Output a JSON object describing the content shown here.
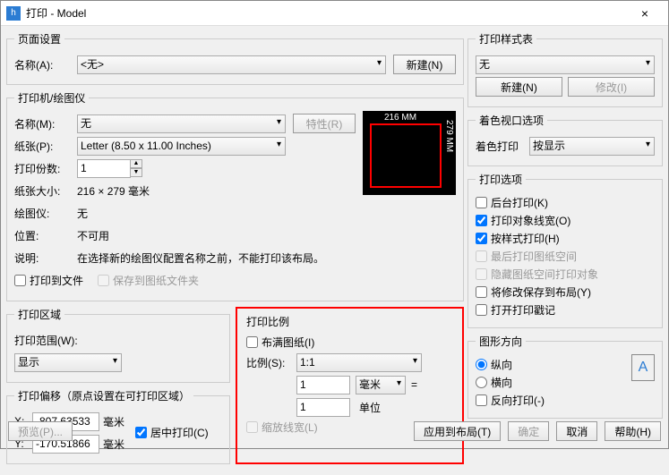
{
  "window": {
    "title": "打印 - Model",
    "close": "×",
    "icon": "h"
  },
  "pageSetup": {
    "legend": "页面设置",
    "nameLabel": "名称(A):",
    "nameValue": "<无>",
    "newBtn": "新建(N)"
  },
  "printer": {
    "legend": "打印机/绘图仪",
    "nameLabel": "名称(M):",
    "nameValue": "无",
    "propsBtn": "特性(R)",
    "paperLabel": "纸张(P):",
    "paperValue": "Letter (8.50 x 11.00 Inches)",
    "copiesLabel": "打印份数:",
    "copiesValue": "1",
    "sizeLabel": "纸张大小:",
    "sizeValue": "216 × 279  毫米",
    "plotterLabel": "绘图仪:",
    "plotterValue": "无",
    "locLabel": "位置:",
    "locValue": "不可用",
    "descLabel": "说明:",
    "descValue": "在选择新的绘图仪配置名称之前，不能打印该布局。",
    "toFile": "打印到文件",
    "saveFolder": "保存到图纸文件夹",
    "previewW": "216 MM",
    "previewH": "279 MM"
  },
  "area": {
    "legend": "打印区域",
    "rangeLabel": "打印范围(W):",
    "rangeValue": "显示"
  },
  "offset": {
    "legend": "打印偏移（原点设置在可打印区域）",
    "xLabel": "X:",
    "xValue": "-807.63533",
    "yLabel": "Y:",
    "yValue": "-170.51866",
    "unit": "毫米",
    "center": "居中打印(C)"
  },
  "scale": {
    "legend": "打印比例",
    "fit": "布满图纸(I)",
    "ratioLabel": "比例(S):",
    "ratioValue": "1:1",
    "val1": "1",
    "unit1": "毫米",
    "eq": "=",
    "val2": "1",
    "unit2": "单位",
    "scaleLw": "缩放线宽(L)"
  },
  "styleTable": {
    "legend": "打印样式表",
    "value": "无",
    "newBtn": "新建(N)",
    "editBtn": "修改(I)"
  },
  "viewport": {
    "legend": "着色视口选项",
    "label": "着色打印",
    "value": "按显示"
  },
  "options": {
    "legend": "打印选项",
    "bg": "后台打印(K)",
    "lw": "打印对象线宽(O)",
    "style": "按样式打印(H)",
    "last": "最后打印图纸空间",
    "hide": "隐藏图纸空间打印对象",
    "save": "将修改保存到布局(Y)",
    "stamp": "打开打印戳记"
  },
  "orient": {
    "legend": "图形方向",
    "portrait": "纵向",
    "landscape": "横向",
    "reverse": "反向打印(-)",
    "icon": "A"
  },
  "footer": {
    "preview": "预览(P)...",
    "apply": "应用到布局(T)",
    "ok": "确定",
    "cancel": "取消",
    "help": "帮助(H)"
  }
}
